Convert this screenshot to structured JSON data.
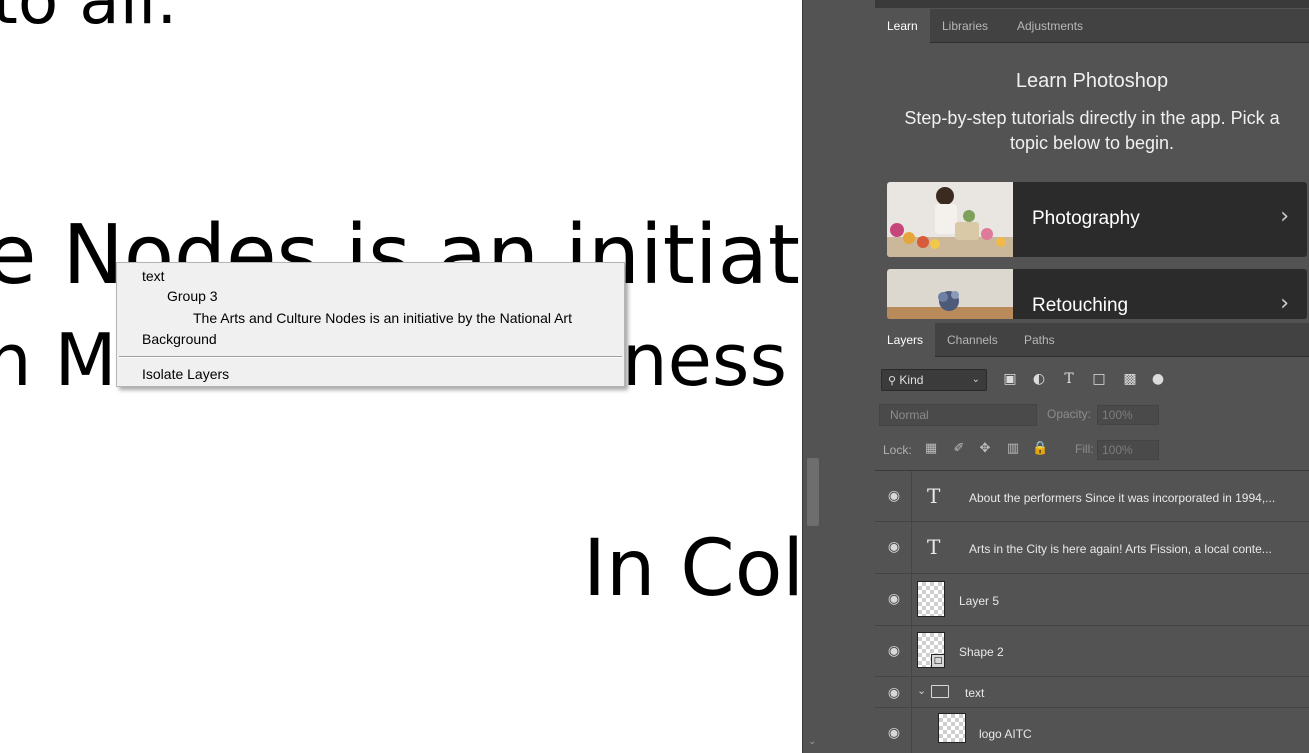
{
  "canvas": {
    "line0": "to all.",
    "line1": "e Nodes is an initiative",
    "line2": "n M",
    "line2b": "ness",
    "line3": "In Coll"
  },
  "learn_panel": {
    "tabs": [
      {
        "label": "Learn",
        "active": true
      },
      {
        "label": "Libraries",
        "active": false
      },
      {
        "label": "Adjustments",
        "active": false
      }
    ],
    "title": "Learn Photoshop",
    "subtitle": "Step-by-step tutorials directly in the app. Pick a topic below to begin.",
    "cards": [
      {
        "label": "Photography"
      },
      {
        "label": "Retouching"
      }
    ]
  },
  "layers_panel": {
    "tabs": [
      {
        "label": "Layers",
        "active": true
      },
      {
        "label": "Channels",
        "active": false
      },
      {
        "label": "Paths",
        "active": false
      }
    ],
    "kind_filter": "Kind",
    "blend_mode": "Normal",
    "opacity_label": "Opacity:",
    "opacity_value": "100%",
    "lock_label": "Lock:",
    "fill_label": "Fill:",
    "fill_value": "100%",
    "layers": [
      {
        "name": "About the performers Since it was incorporated in 1994,...",
        "type": "text"
      },
      {
        "name": "Arts in the City is here again! Arts Fission, a local conte...",
        "type": "text"
      },
      {
        "name": "Layer 5",
        "type": "pixel"
      },
      {
        "name": "Shape 2",
        "type": "shape"
      },
      {
        "name": "text",
        "type": "group"
      },
      {
        "name": "logo AITC",
        "type": "pixel"
      }
    ]
  },
  "context_menu": {
    "items": [
      "text",
      "Group 3",
      "The Arts and Culture Nodes is an initiative by the National Art",
      "Background",
      "Isolate Layers"
    ]
  }
}
